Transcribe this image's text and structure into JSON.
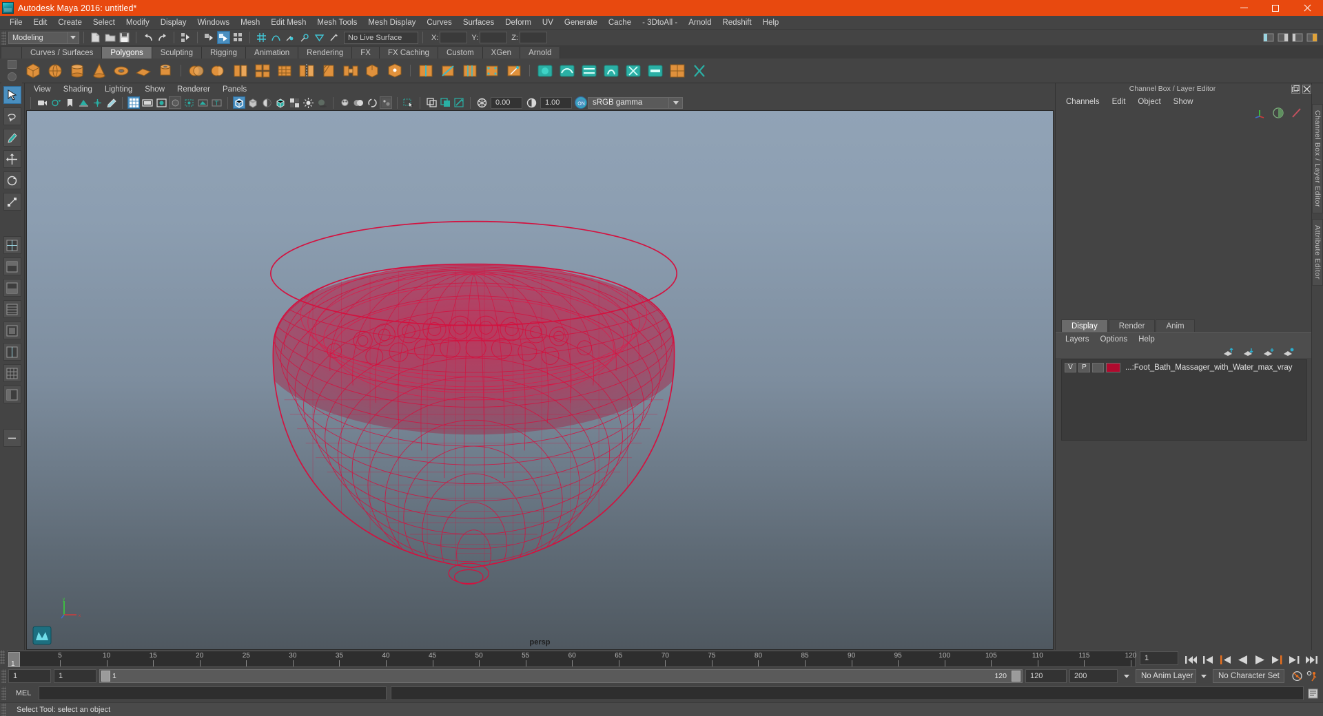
{
  "window": {
    "title": "Autodesk Maya 2016: untitled*",
    "logo_icon": "maya-logo-icon",
    "minimize_icon": "minimize-icon",
    "maximize_icon": "maximize-icon",
    "close_icon": "close-icon",
    "accent_color": "#e8490f"
  },
  "menubar": {
    "items": [
      "File",
      "Edit",
      "Create",
      "Select",
      "Modify",
      "Display",
      "Windows",
      "Mesh",
      "Edit Mesh",
      "Mesh Tools",
      "Mesh Display",
      "Curves",
      "Surfaces",
      "Deform",
      "UV",
      "Generate",
      "Cache",
      "- 3DtoAll -",
      "Arnold",
      "Redshift",
      "Help"
    ]
  },
  "statusbar": {
    "mode": "Modeling",
    "live_surface": "No Live Surface",
    "axis_labels": [
      "X:",
      "Y:",
      "Z:"
    ],
    "axis_values": [
      "",
      "",
      ""
    ]
  },
  "shelf": {
    "tabs": [
      "Curves / Surfaces",
      "Polygons",
      "Sculpting",
      "Rigging",
      "Animation",
      "Rendering",
      "FX",
      "FX Caching",
      "Custom",
      "XGen",
      "Arnold"
    ],
    "active_tab": "Polygons"
  },
  "toolbox": {
    "items": [
      "select-tool",
      "lasso-select-tool",
      "paint-select-tool",
      "move-tool",
      "rotate-tool",
      "scale-tool",
      "last-tool",
      "snap-grid",
      "layout-four-view",
      "layout-persp-outliner",
      "layout-persp-graph",
      "layout-hypershade",
      "layout-persp-only",
      "layout-two-pane",
      "layout-more"
    ],
    "selected": "select-tool"
  },
  "viewport": {
    "panel_menu": [
      "View",
      "Shading",
      "Lighting",
      "Show",
      "Renderer",
      "Panels"
    ],
    "camera_label": "persp",
    "exposure": "0.00",
    "gamma": "1.00",
    "color_profile": "sRGB gamma",
    "color_management_toggle": "ON",
    "wireframe_color": "#d4113f",
    "background_top": "#91a3b6",
    "background_bottom": "#4f5860"
  },
  "right_panel": {
    "dock_title": "Channel Box / Layer Editor",
    "undock_icon": "undock-icon",
    "close_icon": "close-icon",
    "channel_menu": [
      "Channels",
      "Edit",
      "Object",
      "Show"
    ],
    "channel_icons": [
      "axis-gizmo-icon",
      "sphere-half-icon",
      "wrench-icon"
    ],
    "layer_tabs": [
      "Display",
      "Render",
      "Anim"
    ],
    "active_layer_tab": "Display",
    "layer_menu": [
      "Layers",
      "Options",
      "Help"
    ],
    "layer_tool_icons": [
      "move-layer-up-icon",
      "move-layer-down-icon",
      "new-layer-icon",
      "new-layer-from-selected-icon"
    ],
    "layers": [
      {
        "visibility": "V",
        "playback": "P",
        "shading": "",
        "color": "#b00a2e",
        "name": "...:Foot_Bath_Massager_with_Water_max_vray"
      }
    ]
  },
  "dockbar": {
    "tabs": [
      "Channel Box / Layer Editor",
      "Attribute Editor"
    ]
  },
  "timeline": {
    "tick_labels": [
      "5",
      "10",
      "15",
      "20",
      "25",
      "30",
      "35",
      "40",
      "45",
      "50",
      "55",
      "60",
      "65",
      "70",
      "75",
      "80",
      "85",
      "90",
      "95",
      "100",
      "105",
      "110",
      "115",
      "120"
    ],
    "start": 1,
    "end": 120,
    "current_frame": "1",
    "current_frame_marker": "1",
    "playback_icons": [
      "go-to-start-icon",
      "step-back-keyframe-icon",
      "step-back-frame-icon",
      "play-backwards-icon",
      "play-forwards-icon",
      "step-forward-frame-icon",
      "step-forward-keyframe-icon",
      "go-to-end-icon"
    ]
  },
  "range": {
    "range_start": "1",
    "range_end": "1",
    "slider_start_label": "1",
    "slider_end_label": "120",
    "anim_end": "120",
    "playback_end": "200",
    "anim_layer": "No Anim Layer",
    "character_set": "No Character Set",
    "auto_key_icon": "auto-keyframe-icon",
    "anim_prefs_icon": "animation-preferences-icon"
  },
  "command_line": {
    "language_label": "MEL",
    "input_value": "",
    "output_value": "",
    "help_icon": "script-editor-icon"
  },
  "status": {
    "message": "Select Tool: select an object"
  }
}
